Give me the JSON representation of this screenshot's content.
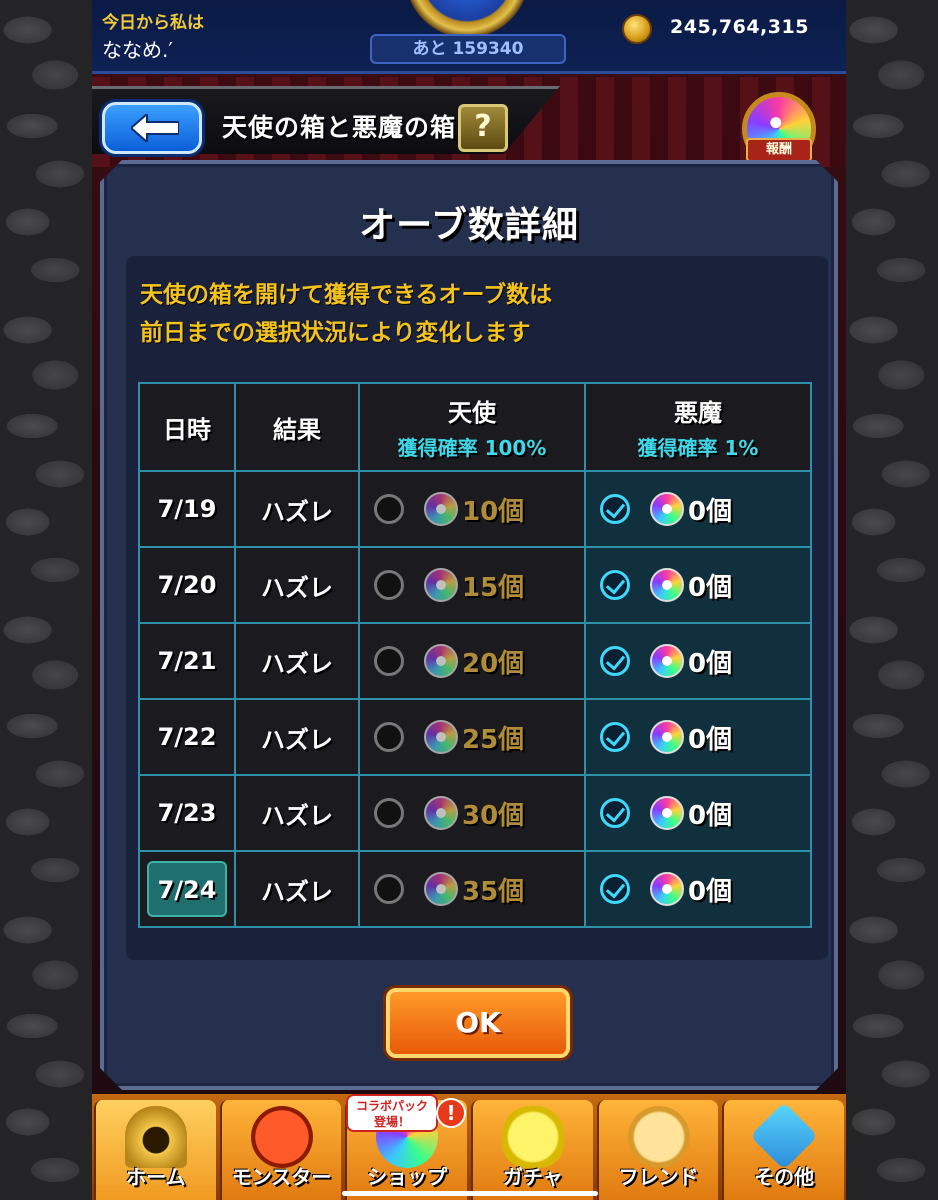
{
  "topbar": {
    "message_line1": "今日から私は",
    "message_line2": "ななめ.′",
    "remaining": "あと 159340",
    "coins": "245,764,315"
  },
  "header": {
    "title": "天使の箱と悪魔の箱",
    "help": "?",
    "reward_label": "報酬"
  },
  "dialog": {
    "title": "オーブ数詳細",
    "description_line1": "天使の箱を開けて獲得できるオーブ数は",
    "description_line2": "前日までの選択状況により変化します",
    "table": {
      "headers": {
        "date": "日時",
        "result": "結果",
        "angel": "天使",
        "angel_rate": "獲得確率 100%",
        "devil": "悪魔",
        "devil_rate": "獲得確率 1%"
      },
      "rows": [
        {
          "date": "7/19",
          "result": "ハズレ",
          "angel_count": "10個",
          "devil_count": "0個"
        },
        {
          "date": "7/20",
          "result": "ハズレ",
          "angel_count": "15個",
          "devil_count": "0個"
        },
        {
          "date": "7/21",
          "result": "ハズレ",
          "angel_count": "20個",
          "devil_count": "0個"
        },
        {
          "date": "7/22",
          "result": "ハズレ",
          "angel_count": "25個",
          "devil_count": "0個"
        },
        {
          "date": "7/23",
          "result": "ハズレ",
          "angel_count": "30個",
          "devil_count": "0個"
        },
        {
          "date": "7/24",
          "result": "ハズレ",
          "angel_count": "35個",
          "devil_count": "0個"
        }
      ]
    },
    "ok_label": "OK"
  },
  "nav": {
    "collab_badge_line1": "コラボパック",
    "collab_badge_line2": "登場！",
    "alert": "!",
    "items": [
      {
        "label": "ホーム"
      },
      {
        "label": "モンスター"
      },
      {
        "label": "ショップ"
      },
      {
        "label": "ガチャ"
      },
      {
        "label": "フレンド"
      },
      {
        "label": "その他"
      }
    ]
  },
  "colors": {
    "accent_yellow": "#f4c21e",
    "accent_cyan": "#3ed8e8",
    "ok_orange": "#e85a08"
  }
}
